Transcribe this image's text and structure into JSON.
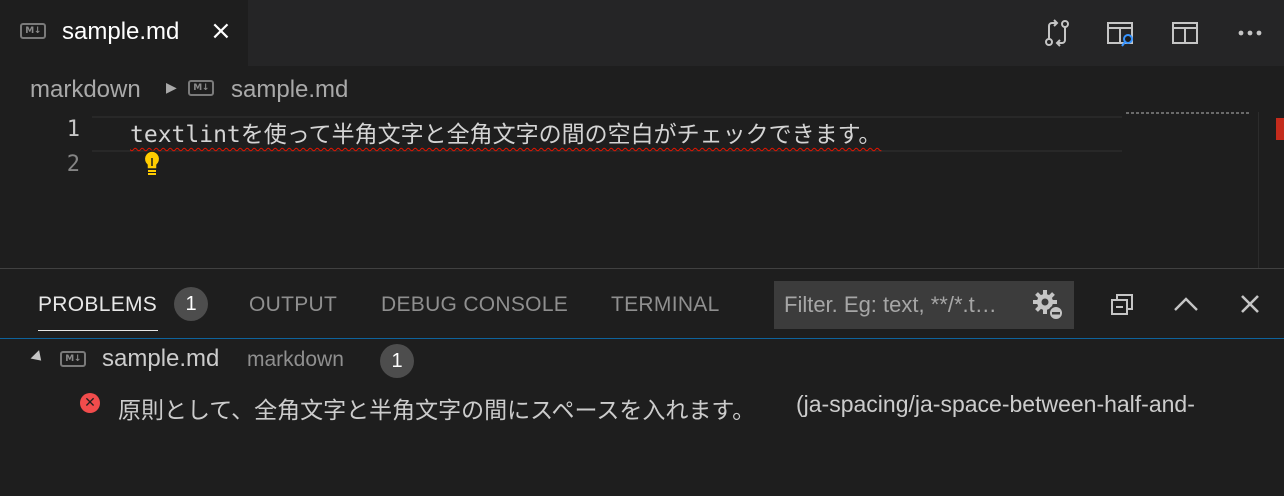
{
  "tab": {
    "icon": "markdown-file-icon",
    "icon_text": "M↓",
    "label": "sample.md",
    "close": "×"
  },
  "editor_actions": [
    "source-control-compare-icon",
    "open-preview-icon",
    "split-editor-icon",
    "more-actions-icon"
  ],
  "breadcrumb": {
    "root": "markdown",
    "separator": "▶",
    "file_icon_text": "M↓",
    "file": "sample.md"
  },
  "editor": {
    "line_numbers": [
      "1",
      "2"
    ],
    "line1": "textlintを使って半角文字と全角文字の間の空白がチェックできます。",
    "lightbulb": "lightbulb-icon"
  },
  "panel": {
    "tabs": {
      "problems": "PROBLEMS",
      "problems_count": "1",
      "output": "OUTPUT",
      "debug_console": "DEBUG CONSOLE",
      "terminal": "TERMINAL"
    },
    "filter_placeholder": "Filter. Eg: text, **/*.t…",
    "actions": [
      "filter-settings-icon",
      "collapse-all-icon",
      "maximize-panel-icon",
      "close-panel-icon"
    ]
  },
  "problems": {
    "file": {
      "icon_text": "M↓",
      "name": "sample.md",
      "dir": "markdown",
      "count": "1"
    },
    "items": [
      {
        "severity": "error",
        "icon_text": "✕",
        "message": "原則として、全角文字と半角文字の間にスペースを入れます。",
        "source": "(ja-spacing/ja-space-between-half-and-"
      }
    ]
  },
  "colors": {
    "background": "#1e1e1e",
    "tabbar": "#252526",
    "accent": "#0e639c",
    "error": "#f14c4c",
    "squiggle": "#e51400",
    "lightbulb": "#ffcc00"
  }
}
